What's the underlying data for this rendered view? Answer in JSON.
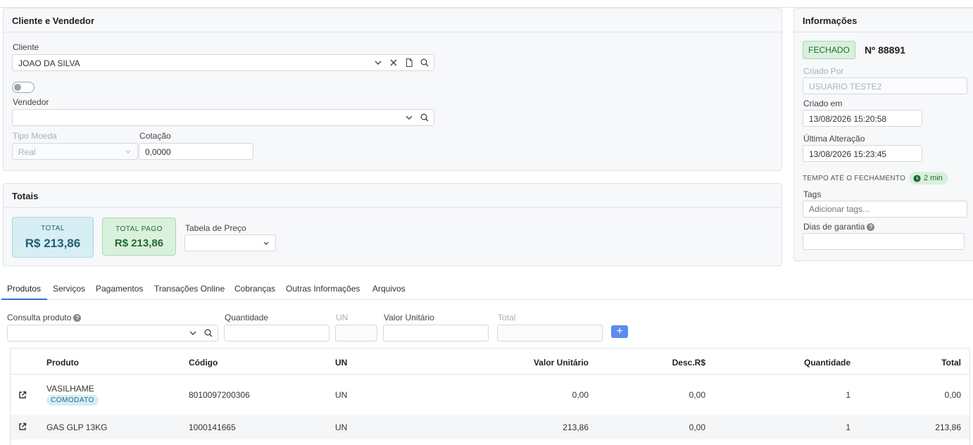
{
  "cliente_vendedor": {
    "title": "Cliente e Vendedor",
    "cliente_label": "Cliente",
    "cliente_value": "JOAO DA SILVA",
    "vendedor_label": "Vendedor",
    "vendedor_value": "",
    "tipo_moeda_label": "Tipo Moeda",
    "tipo_moeda_value": "Real",
    "cotacao_label": "Cotação",
    "cotacao_value": "0,0000"
  },
  "totais": {
    "title": "Totais",
    "total_label": "TOTAL",
    "total_value": "R$ 213,86",
    "total_pago_label": "TOTAL PAGO",
    "total_pago_value": "R$ 213,86",
    "tabela_preco_label": "Tabela de Preço",
    "tabela_preco_value": ""
  },
  "informacoes": {
    "title": "Informações",
    "status": "FECHADO",
    "numero": "Nº 88891",
    "criado_por_label": "Criado Por",
    "criado_por_value": "USUARIO TESTE2",
    "criado_em_label": "Criado em",
    "criado_em_value": "13/08/2026 15:20:58",
    "ultima_alteracao_label": "Última Alteração",
    "ultima_alteracao_value": "13/08/2026 15:23:45",
    "tempo_label": "TEMPO ATÉ O FECHAMENTO",
    "tempo_value": "2 min",
    "tags_label": "Tags",
    "tags_placeholder": "Adicionar tags...",
    "dias_garantia_label": "Dias de garantia",
    "dias_garantia_value": ""
  },
  "tabs": [
    "Produtos",
    "Serviços",
    "Pagamentos",
    "Transações Online",
    "Cobranças",
    "Outras Informações",
    "Arquivos"
  ],
  "entry": {
    "consulta_label": "Consulta produto",
    "quantidade_label": "Quantidade",
    "un_label": "UN",
    "valor_unitario_label": "Valor Unitário",
    "total_label": "Total"
  },
  "table": {
    "headers": [
      "Produto",
      "Código",
      "UN",
      "Valor Unitário",
      "Desc.R$",
      "Quantidade",
      "Total"
    ],
    "rows": [
      {
        "produto": "VASILHAME",
        "badge": "COMODATO",
        "codigo": "8010097200306",
        "un": "UN",
        "valor_unitario": "0,00",
        "desc": "0,00",
        "quantidade": "1",
        "total": "0,00"
      },
      {
        "produto": "GAS GLP 13KG",
        "badge": "",
        "codigo": "1000141665",
        "un": "UN",
        "valor_unitario": "213,86",
        "desc": "0,00",
        "quantidade": "1",
        "total": "213,86"
      }
    ]
  },
  "colors": {
    "accent": "#2d6fd6",
    "status_green": "#d9f0dc",
    "total_card": "#d6eef4",
    "total_pago_card": "#d9f0dc"
  }
}
